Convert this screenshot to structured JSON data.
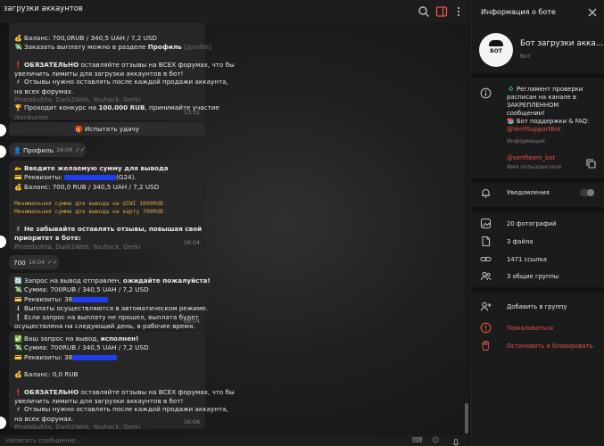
{
  "chat": {
    "title": "загрузки аккаунтов",
    "composer_placeholder": "Написать сообщение...",
    "msg1": {
      "l1": "Баланс: 700,0RUB  / 340,5 UAH / 7,2 USD",
      "l2a": "Заказать выплату можно в разделе ",
      "l2b": "Профиль",
      "l2c": " [/profile]",
      "l4a": "ОБЯЗАТЕЛЬНО",
      "l4b": " оставляйте отзывы на ВСЕХ форумах, что бы",
      "l5": "увеличить лимиты для загрузки аккаунтов в бот!",
      "l6": "Отзывы нужно оставлять после каждой продажи аккаунта,",
      "l7": "на всех форумах.",
      "l8": "Piratebuhta, Dark2Web, Youhack, Gerki",
      "l9a": "Проходит конкурс на ",
      "l9b": "100.000 RUB",
      "l9c": ", принимайте участие",
      "l10": "/konkurses",
      "time": "13:31"
    },
    "inline_button": "Испытать удачу",
    "out1": {
      "text": "Профиль",
      "time": "16:04"
    },
    "msg2": {
      "l1": "Введите желаемую сумму для вывода",
      "l2a": "Реквизиты: ",
      "l2b": "(G24).",
      "l3": "Баланс: 700,0 RUB  / 340,5 UAH / 7,2 USD",
      "l4": "Минимальная сумма для вывода на QIWI 1000RUB",
      "l5": "Минимальная сумма для вывода на карту 700RUB",
      "l6": "Не забывайте оставлять отзывы, повышая свой",
      "l7": "приоритет в боте:",
      "l8": "Piratebuhta, Dark2Web, Youhack, Gerki",
      "time": "16:04"
    },
    "out2": {
      "text": "700",
      "time": "16:04"
    },
    "msg3": {
      "l1a": "Запрос на вывод  отправлен, ",
      "l1b": "ожидайте пожалуйста!",
      "l2": "Сумма: 700RUB  / 340,5 UAH / 7,2 USD",
      "l3": "Реквизиты: 38",
      "l4": "Выплаты осуществляются в автоматическом режиме.",
      "l5": "Если запрос на выплату не прошел, выплата будет",
      "l6": "осуществлена на следующий день, в рабочее время.",
      "time": "16:04"
    },
    "msg4": {
      "l1a": "Ваш запрос на вывод, ",
      "l1b": "исполнен!",
      "l2": "Сумма: 700RUB  / 340,5 UAH / 7,2 USD",
      "l3": "Реквизиты: 38",
      "l4": "Баланс: 0,0 RUB",
      "l5a": "ОБЯЗАТЕЛЬНО",
      "l5b": " оставляйте отзывы на ВСЕХ форумах, что бы",
      "l6": "увеличить лимиты для загрузки аккаунтов в бот!",
      "l7": "Отзывы нужно оставлять после каждой продажи аккаунта,",
      "l8": "на всех форумах.",
      "l9": "Piratebuhta, Dark2Web, Youhack, Gerki",
      "time": "16:06"
    }
  },
  "panel": {
    "title": "Информация о боте",
    "bot_name": "Бот загрузки акка...",
    "bot_sub": "бот",
    "avatar_label": "БОТ",
    "desc_l1": "Регламент проверки",
    "desc_l2": "расписан на канале в",
    "desc_l3": "ЗАКРЕПЛЕННОМ",
    "desc_l4": "сообщении!",
    "desc_l5": "Бот поддержки & FAQ:",
    "desc_link": "@VerifSupportBot",
    "desc_caption": "Информация",
    "username": "@verifteam_bot",
    "username_caption": "Имя пользователя",
    "notifications": "Уведомления",
    "photos": "20 фотографий",
    "files": "3 файла",
    "links": "1471 ссылка",
    "groups": "3 общие группы",
    "add_to_group": "Добавить в группу",
    "report": "Пожаловаться",
    "stop_block": "Остановить и блокировать"
  }
}
